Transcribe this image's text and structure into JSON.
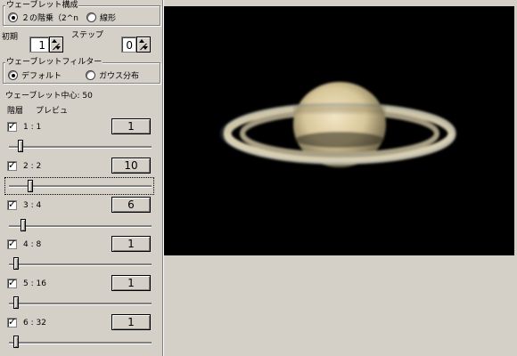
{
  "wavelet_config": {
    "legend": "ウェーブレット構成",
    "option_2level": "２の階乗（2^n",
    "option_linear": "線形",
    "selected": "2level"
  },
  "initial": {
    "label": "初期",
    "value": "1"
  },
  "step": {
    "label": "ステップ",
    "value": "0"
  },
  "wavelet_filter": {
    "legend": "ウェーブレットフィルター",
    "option_default": "デフォルト",
    "option_gauss": "ガウス分布",
    "selected": "default"
  },
  "wavelet_center": "ウェーブレット中心: 50",
  "header": {
    "level": "階層",
    "preview": "プレビュ"
  },
  "layers": [
    {
      "label": "1 : 1",
      "value": "1",
      "checked": true,
      "slider": 0.08
    },
    {
      "label": "2 : 2",
      "value": "10",
      "checked": true,
      "slider": 0.15
    },
    {
      "label": "3 : 4",
      "value": "6",
      "checked": true,
      "slider": 0.1
    },
    {
      "label": "4 : 8",
      "value": "1",
      "checked": true,
      "slider": 0.05
    },
    {
      "label": "5 : 16",
      "value": "1",
      "checked": true,
      "slider": 0.05
    },
    {
      "label": "6 : 32",
      "value": "1",
      "checked": true,
      "slider": 0.05
    }
  ]
}
